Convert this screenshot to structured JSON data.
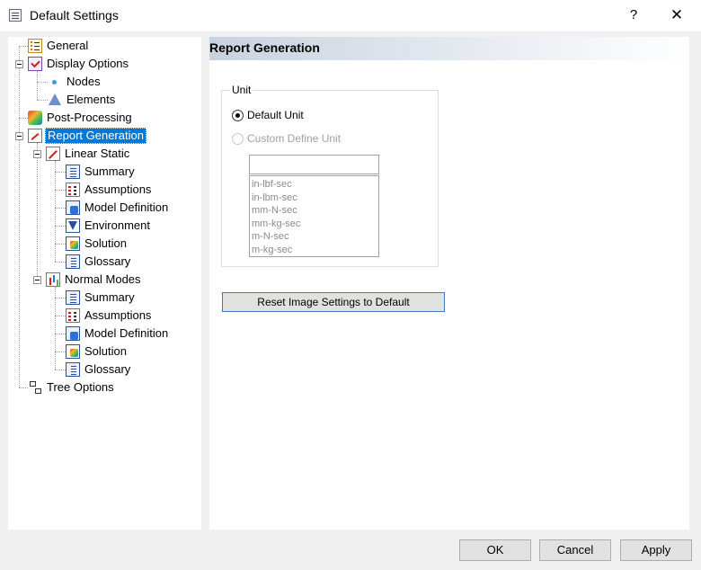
{
  "window": {
    "title": "Default Settings",
    "help": "?",
    "close": "✕"
  },
  "tree": [
    {
      "id": "general",
      "label": "General",
      "icon": "general-icon"
    },
    {
      "id": "display-options",
      "label": "Display Options",
      "icon": "display-options-icon"
    },
    {
      "id": "nodes",
      "label": "Nodes",
      "icon": "nodes-icon"
    },
    {
      "id": "elements",
      "label": "Elements",
      "icon": "elements-icon"
    },
    {
      "id": "post-processing",
      "label": "Post-Processing",
      "icon": "post-processing-icon"
    },
    {
      "id": "report-generation",
      "label": "Report Generation",
      "icon": "report-generation-icon",
      "selected": true
    },
    {
      "id": "linear-static",
      "label": "Linear Static",
      "icon": "linear-static-icon"
    },
    {
      "id": "ls-summary",
      "label": "Summary",
      "icon": "summary-icon"
    },
    {
      "id": "ls-assumptions",
      "label": "Assumptions",
      "icon": "assumptions-icon"
    },
    {
      "id": "ls-model-definition",
      "label": "Model Definition",
      "icon": "model-definition-icon"
    },
    {
      "id": "ls-environment",
      "label": "Environment",
      "icon": "environment-icon"
    },
    {
      "id": "ls-solution",
      "label": "Solution",
      "icon": "solution-icon"
    },
    {
      "id": "ls-glossary",
      "label": "Glossary",
      "icon": "glossary-icon"
    },
    {
      "id": "normal-modes",
      "label": "Normal Modes",
      "icon": "normal-modes-icon"
    },
    {
      "id": "nm-summary",
      "label": "Summary",
      "icon": "summary-icon"
    },
    {
      "id": "nm-assumptions",
      "label": "Assumptions",
      "icon": "assumptions-icon"
    },
    {
      "id": "nm-model-definition",
      "label": "Model Definition",
      "icon": "model-definition-icon"
    },
    {
      "id": "nm-solution",
      "label": "Solution",
      "icon": "solution-icon"
    },
    {
      "id": "nm-glossary",
      "label": "Glossary",
      "icon": "glossary-icon"
    },
    {
      "id": "tree-options",
      "label": "Tree Options",
      "icon": "tree-options-icon"
    }
  ],
  "panel": {
    "title": "Report Generation",
    "unit_group": "Unit",
    "default_unit": "Default Unit",
    "custom_unit": "Custom Define Unit",
    "custom_unit_value": "",
    "unit_options": [
      "in-lbf-sec",
      "in-lbm-sec",
      "mm-N-sec",
      "mm-kg-sec",
      "m-N-sec",
      "m-kg-sec"
    ],
    "reset_button": "Reset Image Settings to Default"
  },
  "buttons": {
    "ok": "OK",
    "cancel": "Cancel",
    "apply": "Apply"
  }
}
